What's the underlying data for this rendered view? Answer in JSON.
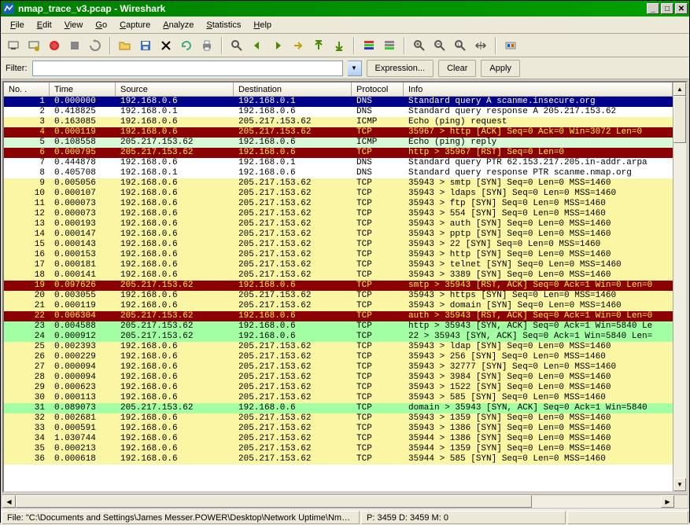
{
  "title": "nmap_trace_v3.pcap - Wireshark",
  "menus": [
    "File",
    "Edit",
    "View",
    "Go",
    "Capture",
    "Analyze",
    "Statistics",
    "Help"
  ],
  "toolbar_icons": [
    "interfaces-icon",
    "options-icon",
    "start-icon",
    "stop-icon",
    "restart-icon",
    "sep",
    "open-icon",
    "save-icon",
    "close-icon",
    "reload-icon",
    "print-icon",
    "sep",
    "find-icon",
    "back-icon",
    "forward-icon",
    "goto-icon",
    "first-icon",
    "last-icon",
    "sep",
    "colorize-icon",
    "autoscroll-icon",
    "sep",
    "zoom-in-icon",
    "zoom-out-icon",
    "zoom-reset-icon",
    "resize-cols-icon",
    "sep",
    "prefs-icon"
  ],
  "filter": {
    "label": "Filter:",
    "value": "",
    "expression_btn": "Expression...",
    "clear_btn": "Clear",
    "apply_btn": "Apply"
  },
  "columns": [
    "No. .",
    "Time",
    "Source",
    "Destination",
    "Protocol",
    "Info"
  ],
  "packets": [
    {
      "no": "1",
      "time": "0.000000",
      "src": "192.168.0.6",
      "dst": "192.168.0.1",
      "proto": "DNS",
      "info": "Standard query A scanme.insecure.org",
      "cls": "r-sel"
    },
    {
      "no": "2",
      "time": "0.418825",
      "src": "192.168.0.1",
      "dst": "192.168.0.6",
      "proto": "DNS",
      "info": "Standard query response A 205.217.153.62",
      "cls": "r-white"
    },
    {
      "no": "3",
      "time": "0.163085",
      "src": "192.168.0.6",
      "dst": "205.217.153.62",
      "proto": "ICMP",
      "info": "Echo (ping) request",
      "cls": "r-yellow"
    },
    {
      "no": "4",
      "time": "0.000119",
      "src": "192.168.0.6",
      "dst": "205.217.153.62",
      "proto": "TCP",
      "info": "35967 > http [ACK] Seq=0 Ack=0 Win=3072 Len=0",
      "cls": "r-red"
    },
    {
      "no": "5",
      "time": "0.108558",
      "src": "205.217.153.62",
      "dst": "192.168.0.6",
      "proto": "ICMP",
      "info": "Echo (ping) reply",
      "cls": "r-lgreen"
    },
    {
      "no": "6",
      "time": "0.000795",
      "src": "205.217.153.62",
      "dst": "192.168.0.6",
      "proto": "TCP",
      "info": "http > 35967 [RST] Seq=0 Len=0",
      "cls": "r-red"
    },
    {
      "no": "7",
      "time": "0.444878",
      "src": "192.168.0.6",
      "dst": "192.168.0.1",
      "proto": "DNS",
      "info": "Standard query PTR 62.153.217.205.in-addr.arpa",
      "cls": "r-white"
    },
    {
      "no": "8",
      "time": "0.405708",
      "src": "192.168.0.1",
      "dst": "192.168.0.6",
      "proto": "DNS",
      "info": "Standard query response PTR scanme.nmap.org",
      "cls": "r-white"
    },
    {
      "no": "9",
      "time": "0.005056",
      "src": "192.168.0.6",
      "dst": "205.217.153.62",
      "proto": "TCP",
      "info": "35943 > smtp [SYN] Seq=0 Len=0 MSS=1460",
      "cls": "r-yellow"
    },
    {
      "no": "10",
      "time": "0.000107",
      "src": "192.168.0.6",
      "dst": "205.217.153.62",
      "proto": "TCP",
      "info": "35943 > ldaps [SYN] Seq=0 Len=0 MSS=1460",
      "cls": "r-yellow"
    },
    {
      "no": "11",
      "time": "0.000073",
      "src": "192.168.0.6",
      "dst": "205.217.153.62",
      "proto": "TCP",
      "info": "35943 > ftp [SYN] Seq=0 Len=0 MSS=1460",
      "cls": "r-yellow"
    },
    {
      "no": "12",
      "time": "0.000073",
      "src": "192.168.0.6",
      "dst": "205.217.153.62",
      "proto": "TCP",
      "info": "35943 > 554 [SYN] Seq=0 Len=0 MSS=1460",
      "cls": "r-yellow"
    },
    {
      "no": "13",
      "time": "0.000193",
      "src": "192.168.0.6",
      "dst": "205.217.153.62",
      "proto": "TCP",
      "info": "35943 > auth [SYN] Seq=0 Len=0 MSS=1460",
      "cls": "r-yellow"
    },
    {
      "no": "14",
      "time": "0.000147",
      "src": "192.168.0.6",
      "dst": "205.217.153.62",
      "proto": "TCP",
      "info": "35943 > pptp [SYN] Seq=0 Len=0 MSS=1460",
      "cls": "r-yellow"
    },
    {
      "no": "15",
      "time": "0.000143",
      "src": "192.168.0.6",
      "dst": "205.217.153.62",
      "proto": "TCP",
      "info": "35943 > 22 [SYN] Seq=0 Len=0 MSS=1460",
      "cls": "r-yellow"
    },
    {
      "no": "16",
      "time": "0.000153",
      "src": "192.168.0.6",
      "dst": "205.217.153.62",
      "proto": "TCP",
      "info": "35943 > http [SYN] Seq=0 Len=0 MSS=1460",
      "cls": "r-yellow"
    },
    {
      "no": "17",
      "time": "0.000181",
      "src": "192.168.0.6",
      "dst": "205.217.153.62",
      "proto": "TCP",
      "info": "35943 > telnet [SYN] Seq=0 Len=0 MSS=1460",
      "cls": "r-yellow"
    },
    {
      "no": "18",
      "time": "0.000141",
      "src": "192.168.0.6",
      "dst": "205.217.153.62",
      "proto": "TCP",
      "info": "35943 > 3389 [SYN] Seq=0 Len=0 MSS=1460",
      "cls": "r-yellow"
    },
    {
      "no": "19",
      "time": "0.097626",
      "src": "205.217.153.62",
      "dst": "192.168.0.6",
      "proto": "TCP",
      "info": "smtp > 35943 [RST, ACK] Seq=0 Ack=1 Win=0 Len=0",
      "cls": "r-red"
    },
    {
      "no": "20",
      "time": "0.003055",
      "src": "192.168.0.6",
      "dst": "205.217.153.62",
      "proto": "TCP",
      "info": "35943 > https [SYN] Seq=0 Len=0 MSS=1460",
      "cls": "r-yellow"
    },
    {
      "no": "21",
      "time": "0.000119",
      "src": "192.168.0.6",
      "dst": "205.217.153.62",
      "proto": "TCP",
      "info": "35943 > domain [SYN] Seq=0 Len=0 MSS=1460",
      "cls": "r-yellow"
    },
    {
      "no": "22",
      "time": "0.006304",
      "src": "205.217.153.62",
      "dst": "192.168.0.6",
      "proto": "TCP",
      "info": "auth > 35943 [RST, ACK] Seq=0 Ack=1 Win=0 Len=0",
      "cls": "r-red"
    },
    {
      "no": "23",
      "time": "0.004588",
      "src": "205.217.153.62",
      "dst": "192.168.0.6",
      "proto": "TCP",
      "info": "http > 35943 [SYN, ACK] Seq=0 Ack=1 Win=5840 Le",
      "cls": "r-green"
    },
    {
      "no": "24",
      "time": "0.000912",
      "src": "205.217.153.62",
      "dst": "192.168.0.6",
      "proto": "TCP",
      "info": "22 > 35943 [SYN, ACK] Seq=0 Ack=1 Win=5840 Len=",
      "cls": "r-green"
    },
    {
      "no": "25",
      "time": "0.002393",
      "src": "192.168.0.6",
      "dst": "205.217.153.62",
      "proto": "TCP",
      "info": "35943 > ldap [SYN] Seq=0 Len=0 MSS=1460",
      "cls": "r-yellow"
    },
    {
      "no": "26",
      "time": "0.000229",
      "src": "192.168.0.6",
      "dst": "205.217.153.62",
      "proto": "TCP",
      "info": "35943 > 256 [SYN] Seq=0 Len=0 MSS=1460",
      "cls": "r-yellow"
    },
    {
      "no": "27",
      "time": "0.000094",
      "src": "192.168.0.6",
      "dst": "205.217.153.62",
      "proto": "TCP",
      "info": "35943 > 32777 [SYN] Seq=0 Len=0 MSS=1460",
      "cls": "r-yellow"
    },
    {
      "no": "28",
      "time": "0.000094",
      "src": "192.168.0.6",
      "dst": "205.217.153.62",
      "proto": "TCP",
      "info": "35943 > 3984 [SYN] Seq=0 Len=0 MSS=1460",
      "cls": "r-yellow"
    },
    {
      "no": "29",
      "time": "0.000623",
      "src": "192.168.0.6",
      "dst": "205.217.153.62",
      "proto": "TCP",
      "info": "35943 > 1522 [SYN] Seq=0 Len=0 MSS=1460",
      "cls": "r-yellow"
    },
    {
      "no": "30",
      "time": "0.000113",
      "src": "192.168.0.6",
      "dst": "205.217.153.62",
      "proto": "TCP",
      "info": "35943 > 585 [SYN] Seq=0 Len=0 MSS=1460",
      "cls": "r-yellow"
    },
    {
      "no": "31",
      "time": "0.089073",
      "src": "205.217.153.62",
      "dst": "192.168.0.6",
      "proto": "TCP",
      "info": "domain > 35943 [SYN, ACK] Seq=0 Ack=1 Win=5840",
      "cls": "r-green"
    },
    {
      "no": "32",
      "time": "0.002681",
      "src": "192.168.0.6",
      "dst": "205.217.153.62",
      "proto": "TCP",
      "info": "35943 > 1359 [SYN] Seq=0 Len=0 MSS=1460",
      "cls": "r-yellow"
    },
    {
      "no": "33",
      "time": "0.000591",
      "src": "192.168.0.6",
      "dst": "205.217.153.62",
      "proto": "TCP",
      "info": "35943 > 1386 [SYN] Seq=0 Len=0 MSS=1460",
      "cls": "r-yellow"
    },
    {
      "no": "34",
      "time": "1.030744",
      "src": "192.168.0.6",
      "dst": "205.217.153.62",
      "proto": "TCP",
      "info": "35944 > 1386 [SYN] Seq=0 Len=0 MSS=1460",
      "cls": "r-yellow"
    },
    {
      "no": "35",
      "time": "0.000213",
      "src": "192.168.0.6",
      "dst": "205.217.153.62",
      "proto": "TCP",
      "info": "35944 > 1359 [SYN] Seq=0 Len=0 MSS=1460",
      "cls": "r-yellow"
    },
    {
      "no": "36",
      "time": "0.000618",
      "src": "192.168.0.6",
      "dst": "205.217.153.62",
      "proto": "TCP",
      "info": "35944 > 585 [SYN] Seq=0 Len=0 MSS=1460",
      "cls": "r-yellow"
    }
  ],
  "status": {
    "file": "File: \"C:\\Documents and Settings\\James Messer.POWER\\Desktop\\Network Uptime\\Nm…",
    "counts": "P: 3459 D: 3459 M: 0",
    "extra": ""
  }
}
